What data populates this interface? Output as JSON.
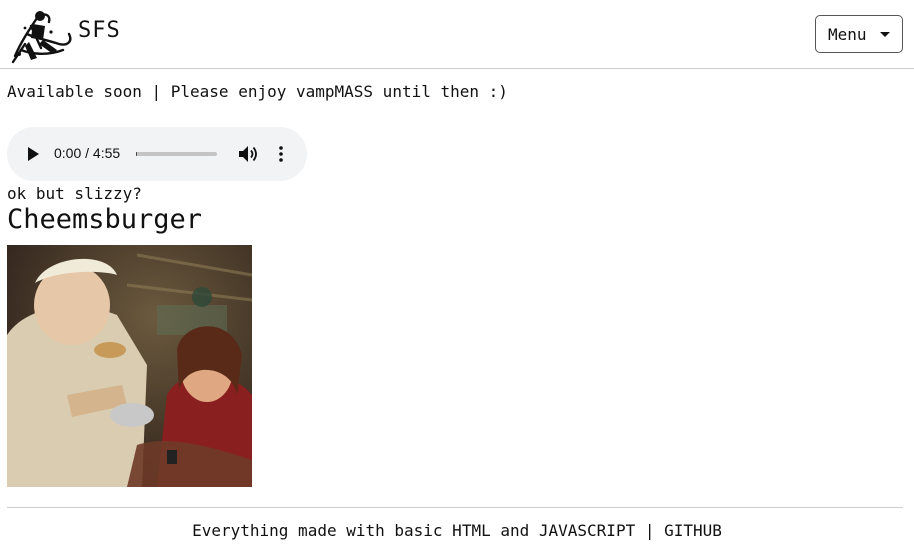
{
  "header": {
    "brand": "SFS",
    "menu_label": "Menu"
  },
  "main": {
    "notice": "Available soon | Please enjoy vampMASS until then :)",
    "audio": {
      "time": "0:00 / 4:55",
      "progress": 0
    },
    "caption": "ok but slizzy?",
    "title": "Cheemsburger"
  },
  "footer": {
    "text": "Everything made with basic HTML and JAVASCRIPT | ",
    "link": "GITHUB"
  }
}
